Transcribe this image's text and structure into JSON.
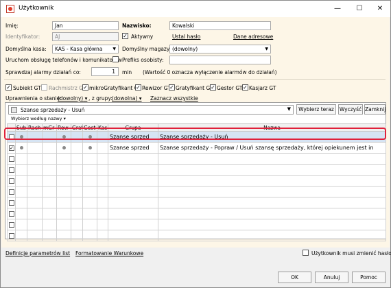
{
  "window": {
    "title": "Użytkownik"
  },
  "form": {
    "imie_label": "Imię:",
    "imie_value": "Jan",
    "nazwisko_label": "Nazwisko:",
    "nazwisko_value": "Kowalski",
    "identyfikator_label": "Identyfikator:",
    "identyfikator_value": "AJ",
    "aktywny_label": "Aktywny",
    "aktywny_checked": "✓",
    "ustal_haslo_link": "Ustal hasło",
    "dane_adresowe_link": "Dane adresowe",
    "domyslna_kasa_label": "Domyślna kasa:",
    "domyslna_kasa_value": "KAS - Kasa główna",
    "domyslny_magazyn_label": "Domyślny magazyn:",
    "domyslny_magazyn_value": "(dowolny)",
    "uruchom_label": "Uruchom obsługę telefonów i komunikatorów",
    "prefiks_label": "Prefiks osobisty:",
    "prefiks_value": "",
    "alarmy_label": "Sprawdzaj alarmy działań co:",
    "alarmy_value": "1",
    "alarmy_unit": "min",
    "alarmy_note": "(Wartość 0 oznacza wyłączenie alarmów do działań)"
  },
  "roles": [
    {
      "label": "Subiekt GT",
      "checked": "✓",
      "disabled": false
    },
    {
      "label": "Rachmistrz GT",
      "checked": "",
      "disabled": true
    },
    {
      "label": "mikroGratyfikant GT",
      "checked": "✓",
      "disabled": false
    },
    {
      "label": "Rewizor GT",
      "checked": "✓",
      "disabled": false
    },
    {
      "label": "Gratyfikant GT",
      "checked": "✓",
      "disabled": false
    },
    {
      "label": "Gestor GT",
      "checked": "✓",
      "disabled": false
    },
    {
      "label": "Kasjarz GT",
      "checked": "✓",
      "disabled": false
    }
  ],
  "filters": {
    "stan_label": "Uprawnienia o stanie:",
    "stan_value": "(dowolny)",
    "grupa_label": ", z grupy:",
    "grupa_value": "(dowolna)",
    "zaznacz_link": "Zaznacz wszystkie"
  },
  "permissions": {
    "combo_value": "Szanse sprzedaży - Usuń",
    "wybierz_teraz": "Wybierz teraz",
    "wyczysc": "Wyczyść",
    "zamknij": "Zamknij",
    "wybierz_wedlug": "Wybierz według nazwy",
    "columns": [
      "",
      "Sub",
      "Rach",
      "mGr",
      "Rew",
      "Grat",
      "Gest",
      "Kas",
      "Grupa",
      "Nazwa"
    ],
    "rows": [
      {
        "checked": "",
        "flags": [
          true,
          false,
          false,
          true,
          false,
          true,
          false
        ],
        "grupa": "Szanse sprzed",
        "nazwa": "Szanse sprzedaży - Usuń",
        "selected": true
      },
      {
        "checked": "✓",
        "flags": [
          true,
          false,
          false,
          true,
          false,
          true,
          false
        ],
        "grupa": "Szanse sprzed",
        "nazwa": "Szanse sprzedaży - Popraw / Usuń szansę sprzedaży, której opiekunem jest in",
        "selected": false
      },
      {
        "checked": "",
        "flags": [
          false,
          false,
          false,
          false,
          false,
          false,
          false
        ],
        "grupa": "",
        "nazwa": "",
        "selected": false
      },
      {
        "checked": "",
        "flags": [
          false,
          false,
          false,
          false,
          false,
          false,
          false
        ],
        "grupa": "",
        "nazwa": "",
        "selected": false
      },
      {
        "checked": "",
        "flags": [
          false,
          false,
          false,
          false,
          false,
          false,
          false
        ],
        "grupa": "",
        "nazwa": "",
        "selected": false
      },
      {
        "checked": "",
        "flags": [
          false,
          false,
          false,
          false,
          false,
          false,
          false
        ],
        "grupa": "",
        "nazwa": "",
        "selected": false
      },
      {
        "checked": "",
        "flags": [
          false,
          false,
          false,
          false,
          false,
          false,
          false
        ],
        "grupa": "",
        "nazwa": "",
        "selected": false
      },
      {
        "checked": "",
        "flags": [
          false,
          false,
          false,
          false,
          false,
          false,
          false
        ],
        "grupa": "",
        "nazwa": "",
        "selected": false
      },
      {
        "checked": "",
        "flags": [
          false,
          false,
          false,
          false,
          false,
          false,
          false
        ],
        "grupa": "",
        "nazwa": "",
        "selected": false
      },
      {
        "checked": "",
        "flags": [
          false,
          false,
          false,
          false,
          false,
          false,
          false
        ],
        "grupa": "",
        "nazwa": "",
        "selected": false
      }
    ]
  },
  "footer": {
    "definicje_link": "Definicje parametrów list",
    "formatowanie_link": "Formatowanie Warunkowe",
    "musi_zmienic_label": "Użytkownik musi zmienić hasło"
  },
  "buttons": {
    "ok": "OK",
    "anuluj": "Anuluj",
    "pomoc": "Pomoc"
  },
  "colors": {
    "form_bg": "#fdf6e7",
    "selection": "#d6e4f3",
    "highlight_border": "#e0203a"
  }
}
